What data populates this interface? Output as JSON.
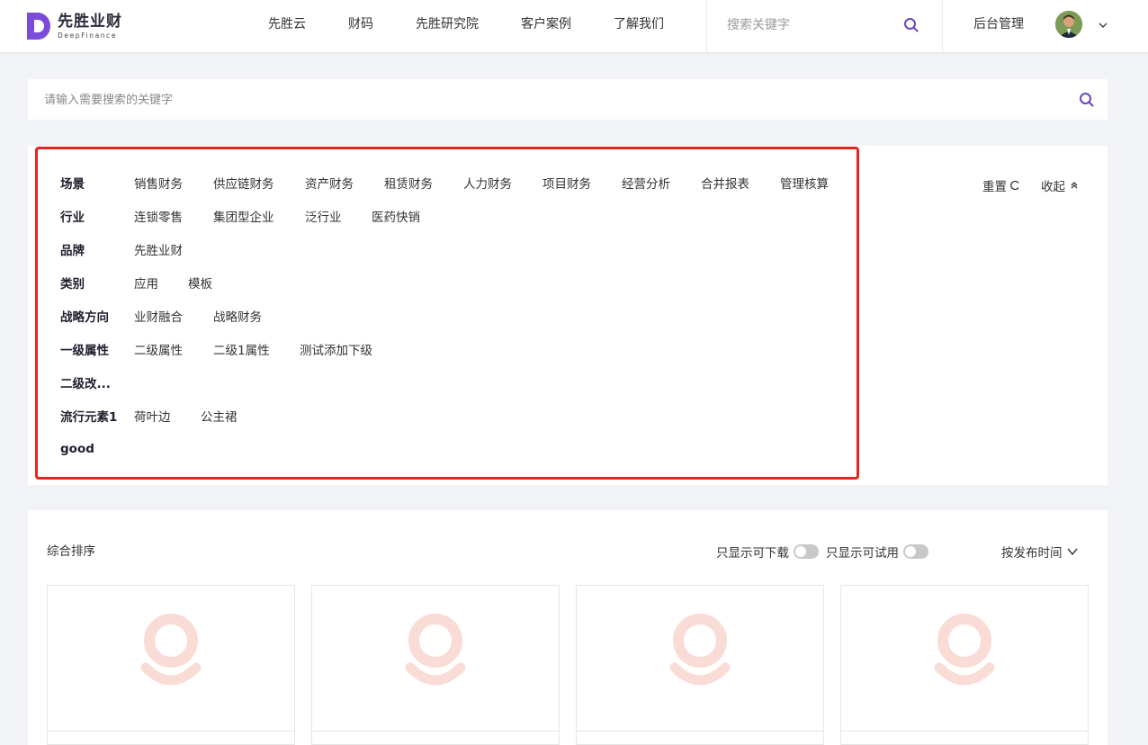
{
  "brand": {
    "name_cn": "先胜业财",
    "name_en": "DeepFinance",
    "color": "#7a4cd9"
  },
  "nav": {
    "items": [
      "先胜云",
      "财码",
      "先胜研究院",
      "客户案例",
      "了解我们"
    ]
  },
  "top_search": {
    "placeholder": "搜索关键字"
  },
  "admin": {
    "label": "后台管理"
  },
  "main_search": {
    "placeholder": "请输入需要搜索的关键字"
  },
  "filters": {
    "reset_label": "重置",
    "collapse_label": "收起",
    "rows": [
      {
        "label": "场景",
        "options": [
          "销售财务",
          "供应链财务",
          "资产财务",
          "租赁财务",
          "人力财务",
          "项目财务",
          "经营分析",
          "合并报表",
          "管理核算"
        ]
      },
      {
        "label": "行业",
        "options": [
          "连锁零售",
          "集团型企业",
          "泛行业",
          "医药快销"
        ]
      },
      {
        "label": "品牌",
        "options": [
          "先胜业财"
        ]
      },
      {
        "label": "类别",
        "options": [
          "应用",
          "模板"
        ]
      },
      {
        "label": "战略方向",
        "options": [
          "业财融合",
          "战略财务"
        ]
      },
      {
        "label": "一级属性",
        "options": [
          "二级属性",
          "二级1属性",
          "测试添加下级"
        ]
      },
      {
        "label": "二级改...",
        "options": []
      },
      {
        "label": "流行元素1",
        "options": [
          "荷叶边",
          "公主裙"
        ]
      },
      {
        "label": "good",
        "options": []
      }
    ],
    "highlight_color": "#e52420"
  },
  "results": {
    "sort_label": "综合排序",
    "toggle_download_label": "只显示可下载",
    "toggle_trial_label": "只显示可试用",
    "sort_time_label": "按发布时间",
    "placeholder_color": "#fadcd6"
  }
}
